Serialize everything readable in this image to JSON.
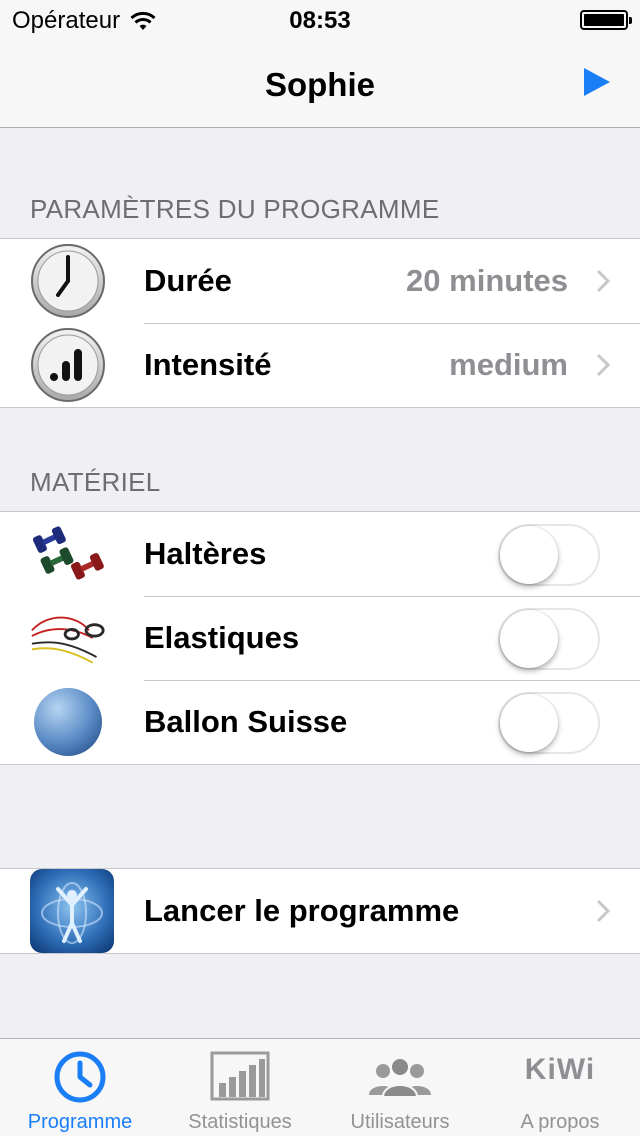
{
  "status_bar": {
    "carrier": "Opérateur",
    "time": "08:53"
  },
  "nav": {
    "title": "Sophie"
  },
  "program_section": {
    "header": "PARAMÈTRES DU PROGRAMME",
    "rows": [
      {
        "label": "Durée",
        "value": "20 minutes",
        "icon": "clock-icon"
      },
      {
        "label": "Intensité",
        "value": "medium",
        "icon": "signal-bars-icon"
      }
    ]
  },
  "equipment_section": {
    "header": "MATÉRIEL",
    "rows": [
      {
        "label": "Haltères",
        "icon": "dumbbells-icon",
        "enabled": false
      },
      {
        "label": "Elastiques",
        "icon": "resistance-bands-icon",
        "enabled": false
      },
      {
        "label": "Ballon Suisse",
        "icon": "swiss-ball-icon",
        "enabled": false
      }
    ]
  },
  "launch": {
    "label": "Lancer le programme",
    "icon": "fitness-figure-icon"
  },
  "tab_bar": {
    "tabs": [
      {
        "label": "Programme",
        "icon": "clock-tab-icon",
        "active": true
      },
      {
        "label": "Statistiques",
        "icon": "bar-chart-icon",
        "active": false
      },
      {
        "label": "Utilisateurs",
        "icon": "users-icon",
        "active": false
      },
      {
        "label": "A propos",
        "icon": "kiwi-logo-icon",
        "active": false,
        "logo_text": "KiWi"
      }
    ]
  },
  "colors": {
    "accent": "#1a7ef7",
    "secondary_text": "#8e8e93",
    "background": "#efeff4"
  }
}
